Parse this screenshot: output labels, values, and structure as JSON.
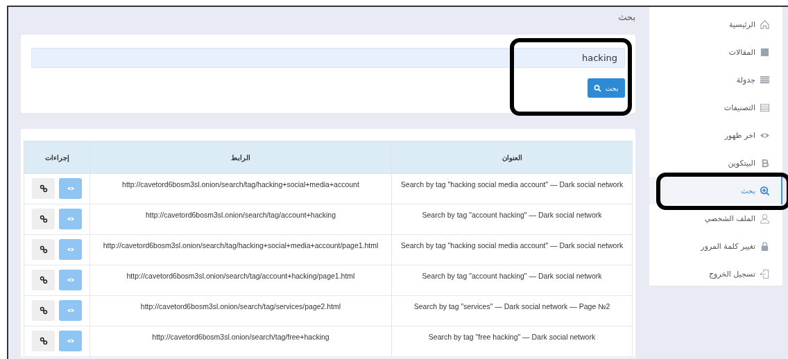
{
  "page_title": "بحث",
  "search": {
    "value": "hacking",
    "button": "بحث",
    "highlighted": true
  },
  "table": {
    "columns": [
      "العنوان",
      "الرابط",
      "إجراءات"
    ],
    "rows": [
      {
        "title": "Search by tag \"hacking social media account\" — Dark social network",
        "link": "http://cavetord6bosm3sl.onion/search/tag/hacking+social+media+account"
      },
      {
        "title": "Search by tag \"account hacking\" — Dark social network",
        "link": "http://cavetord6bosm3sl.onion/search/tag/account+hacking"
      },
      {
        "title": "Search by tag \"hacking social media account\" — Dark social network",
        "link": "http://cavetord6bosm3sl.onion/search/tag/hacking+social+media+account/page1.html"
      },
      {
        "title": "Search by tag \"account hacking\" — Dark social network",
        "link": "http://cavetord6bosm3sl.onion/search/tag/account+hacking/page1.html"
      },
      {
        "title": "Search by tag \"services\" — Dark social network — Page №2",
        "link": "http://cavetord6bosm3sl.onion/search/tag/services/page2.html"
      },
      {
        "title": "Search by tag \"free hacking\" — Dark social network",
        "link": "http://cavetord6bosm3sl.onion/search/tag/free+hacking"
      }
    ]
  },
  "sidebar": {
    "items": [
      {
        "label": "الرئيسية",
        "kind": "home",
        "selected": false,
        "highlighted": false
      },
      {
        "label": "المقالات",
        "kind": "archive",
        "selected": false,
        "highlighted": false
      },
      {
        "label": "جدولة",
        "kind": "list",
        "selected": false,
        "highlighted": false
      },
      {
        "label": "التصنيفات",
        "kind": "table",
        "selected": false,
        "highlighted": false
      },
      {
        "label": "اخر ظهور",
        "kind": "eye",
        "selected": false,
        "highlighted": false
      },
      {
        "label": "البيتكوين",
        "kind": "bitcoin",
        "selected": false,
        "highlighted": false
      },
      {
        "label": "بحث",
        "kind": "search",
        "selected": true,
        "highlighted": true
      },
      {
        "label": "الملف الشخصي",
        "kind": "user",
        "selected": false,
        "highlighted": false
      },
      {
        "label": "تغيير كلمة المرور",
        "kind": "lock",
        "selected": false,
        "highlighted": false
      },
      {
        "label": "تسجيل الخروج",
        "kind": "logout",
        "selected": false,
        "highlighted": false
      }
    ]
  }
}
